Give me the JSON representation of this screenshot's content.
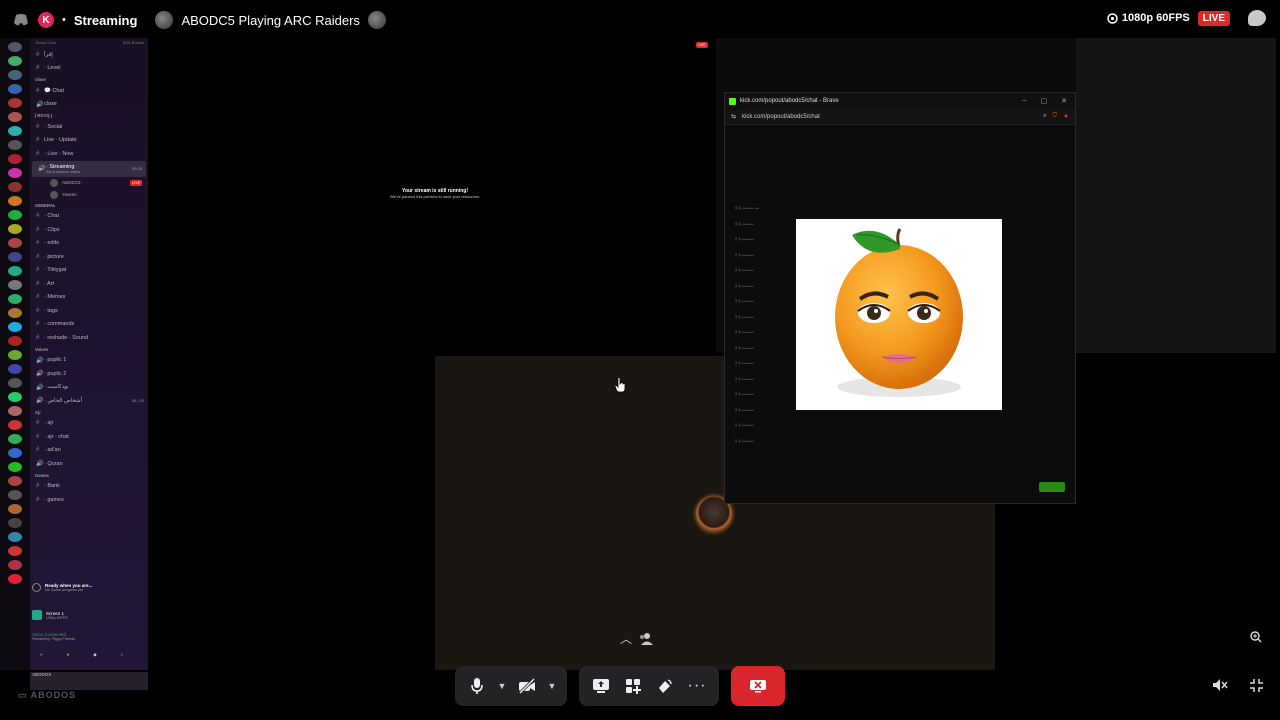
{
  "topbar": {
    "channel_name": "Streaming",
    "stream_title": "ABODC5 Playing ARC Raiders",
    "quality": "1080p 60FPS",
    "live": "LIVE"
  },
  "sidebar": {
    "header_left": "Boost Goal",
    "header_right": "0/28 Boosts",
    "rows": [
      {
        "type": "channel",
        "icon": "#",
        "label": "إقرأ"
      },
      {
        "type": "channel",
        "icon": "#",
        "label": "· Level"
      },
      {
        "type": "category",
        "label": "close"
      },
      {
        "type": "channel",
        "icon": "#",
        "label": "💬 Chat"
      },
      {
        "type": "channel",
        "icon": "🔊",
        "label": "close"
      },
      {
        "type": "category",
        "label": "| RGYQ |"
      },
      {
        "type": "channel",
        "icon": "#",
        "label": "· Social"
      },
      {
        "type": "channel",
        "icon": "#",
        "label": "Live · Update"
      },
      {
        "type": "channel",
        "icon": "#",
        "label": "· Live · Now"
      },
      {
        "type": "active",
        "icon": "🔊",
        "label": "· Streaming",
        "sub": "Set a channel status",
        "time": "59:28"
      },
      {
        "type": "sub",
        "label": "ABODC5",
        "live": "LIVE"
      },
      {
        "type": "sub",
        "label": "Yaseen"
      },
      {
        "type": "category",
        "label": "GENERAL"
      },
      {
        "type": "channel",
        "icon": "#",
        "label": "· Chat"
      },
      {
        "type": "channel",
        "icon": "#",
        "label": "· Clips"
      },
      {
        "type": "channel",
        "icon": "#",
        "label": "· edits"
      },
      {
        "type": "channel",
        "icon": "#",
        "label": "· picture"
      },
      {
        "type": "channel",
        "icon": "#",
        "label": "· Tiktygat"
      },
      {
        "type": "channel",
        "icon": "#",
        "label": "· Art"
      },
      {
        "type": "channel",
        "icon": "#",
        "label": "· Memes"
      },
      {
        "type": "channel",
        "icon": "#",
        "label": "· tags"
      },
      {
        "type": "channel",
        "icon": "#",
        "label": "· commands"
      },
      {
        "type": "channel",
        "icon": "#",
        "label": "· reshade · Sound"
      },
      {
        "type": "category",
        "label": "Voices"
      },
      {
        "type": "channel",
        "icon": "🔊",
        "label": "· puplic 1"
      },
      {
        "type": "channel",
        "icon": "🔊",
        "label": "· puplic 2"
      },
      {
        "type": "channel",
        "icon": "🔊",
        "label": "· بودكاست"
      },
      {
        "type": "channel",
        "icon": "🔊",
        "label": "· أشخاص الخاص",
        "time": "00 | 03"
      },
      {
        "type": "category",
        "label": "Ajr"
      },
      {
        "type": "channel",
        "icon": "#",
        "label": "· ajr"
      },
      {
        "type": "channel",
        "icon": "#",
        "label": "· ajr · chat"
      },
      {
        "type": "channel",
        "icon": "#",
        "label": "· ad'an"
      },
      {
        "type": "channel",
        "icon": "🔊",
        "label": "· Quran"
      },
      {
        "type": "category",
        "label": "Games"
      },
      {
        "type": "channel",
        "icon": "#",
        "label": "· Bank"
      },
      {
        "type": "channel",
        "icon": "#",
        "label": "· games"
      }
    ],
    "quest_title": "Ready when you are...",
    "quest_sub": "No Quest progress yet",
    "screen_label": "Screen 1",
    "screen_sub": "1080p 60FPS",
    "voice_connected": "Voice Connected",
    "voice_channel": "Streaming / Rgyq Friends",
    "username": "ABODOS"
  },
  "stream": {
    "notice_title": "Your stream is still running!",
    "notice_sub": "We've paused this preview to save your resources."
  },
  "brave": {
    "window_title": "kick.com/popout/abodc5/chat - Brave",
    "url": "kick.com/popout/abodc5/chat"
  },
  "colors": {
    "live": "#e02828",
    "end_call": "#d9262c",
    "kick": "#53fc18"
  }
}
